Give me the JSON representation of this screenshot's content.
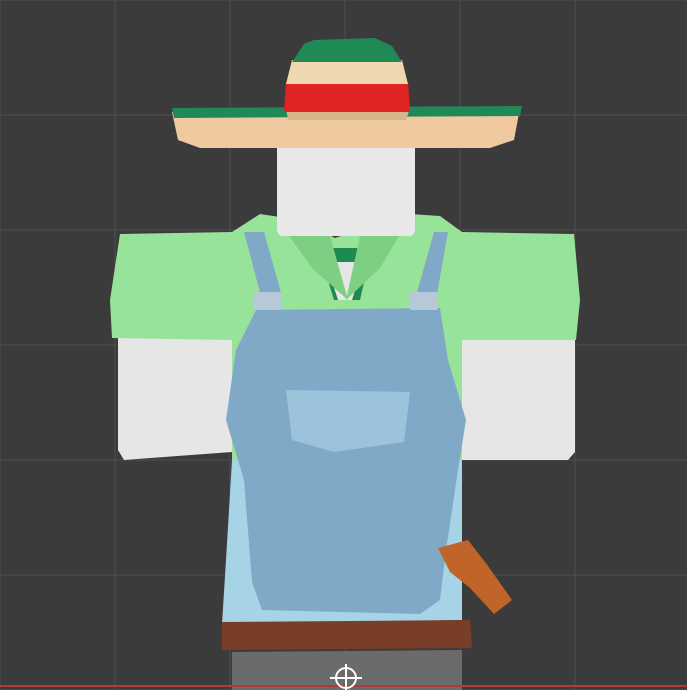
{
  "viewport": {
    "background": "#3b3b3b",
    "grid_color": "#4f4f4f",
    "axis_color": "#b03a3a"
  },
  "avatar": {
    "hat": {
      "brim_top": "#1f8a55",
      "brim_bottom": "#f0c9a0",
      "crown_green": "#1f8a55",
      "crown_cream": "#efd7b0",
      "crown_red": "#e02424",
      "crown_tan": "#d7b48a"
    },
    "head_color": "#e8e8e8",
    "shirt_color": "#98e39a",
    "shirt_shadow": "#7fcf82",
    "undershirt_color": "#1d8a4f",
    "arm_skin": "#e6e6e6",
    "overalls_color": "#7fa9c7",
    "overalls_light": "#9bc4dc",
    "pants_color": "#a7d3e6",
    "belt_color": "#7a3d28",
    "holster_color": "#c0642a",
    "buckle_color": "#b7c9d9",
    "shoe_color": "#6b6b6b"
  },
  "icons": {
    "pivot": "pivot-crosshair-icon"
  }
}
